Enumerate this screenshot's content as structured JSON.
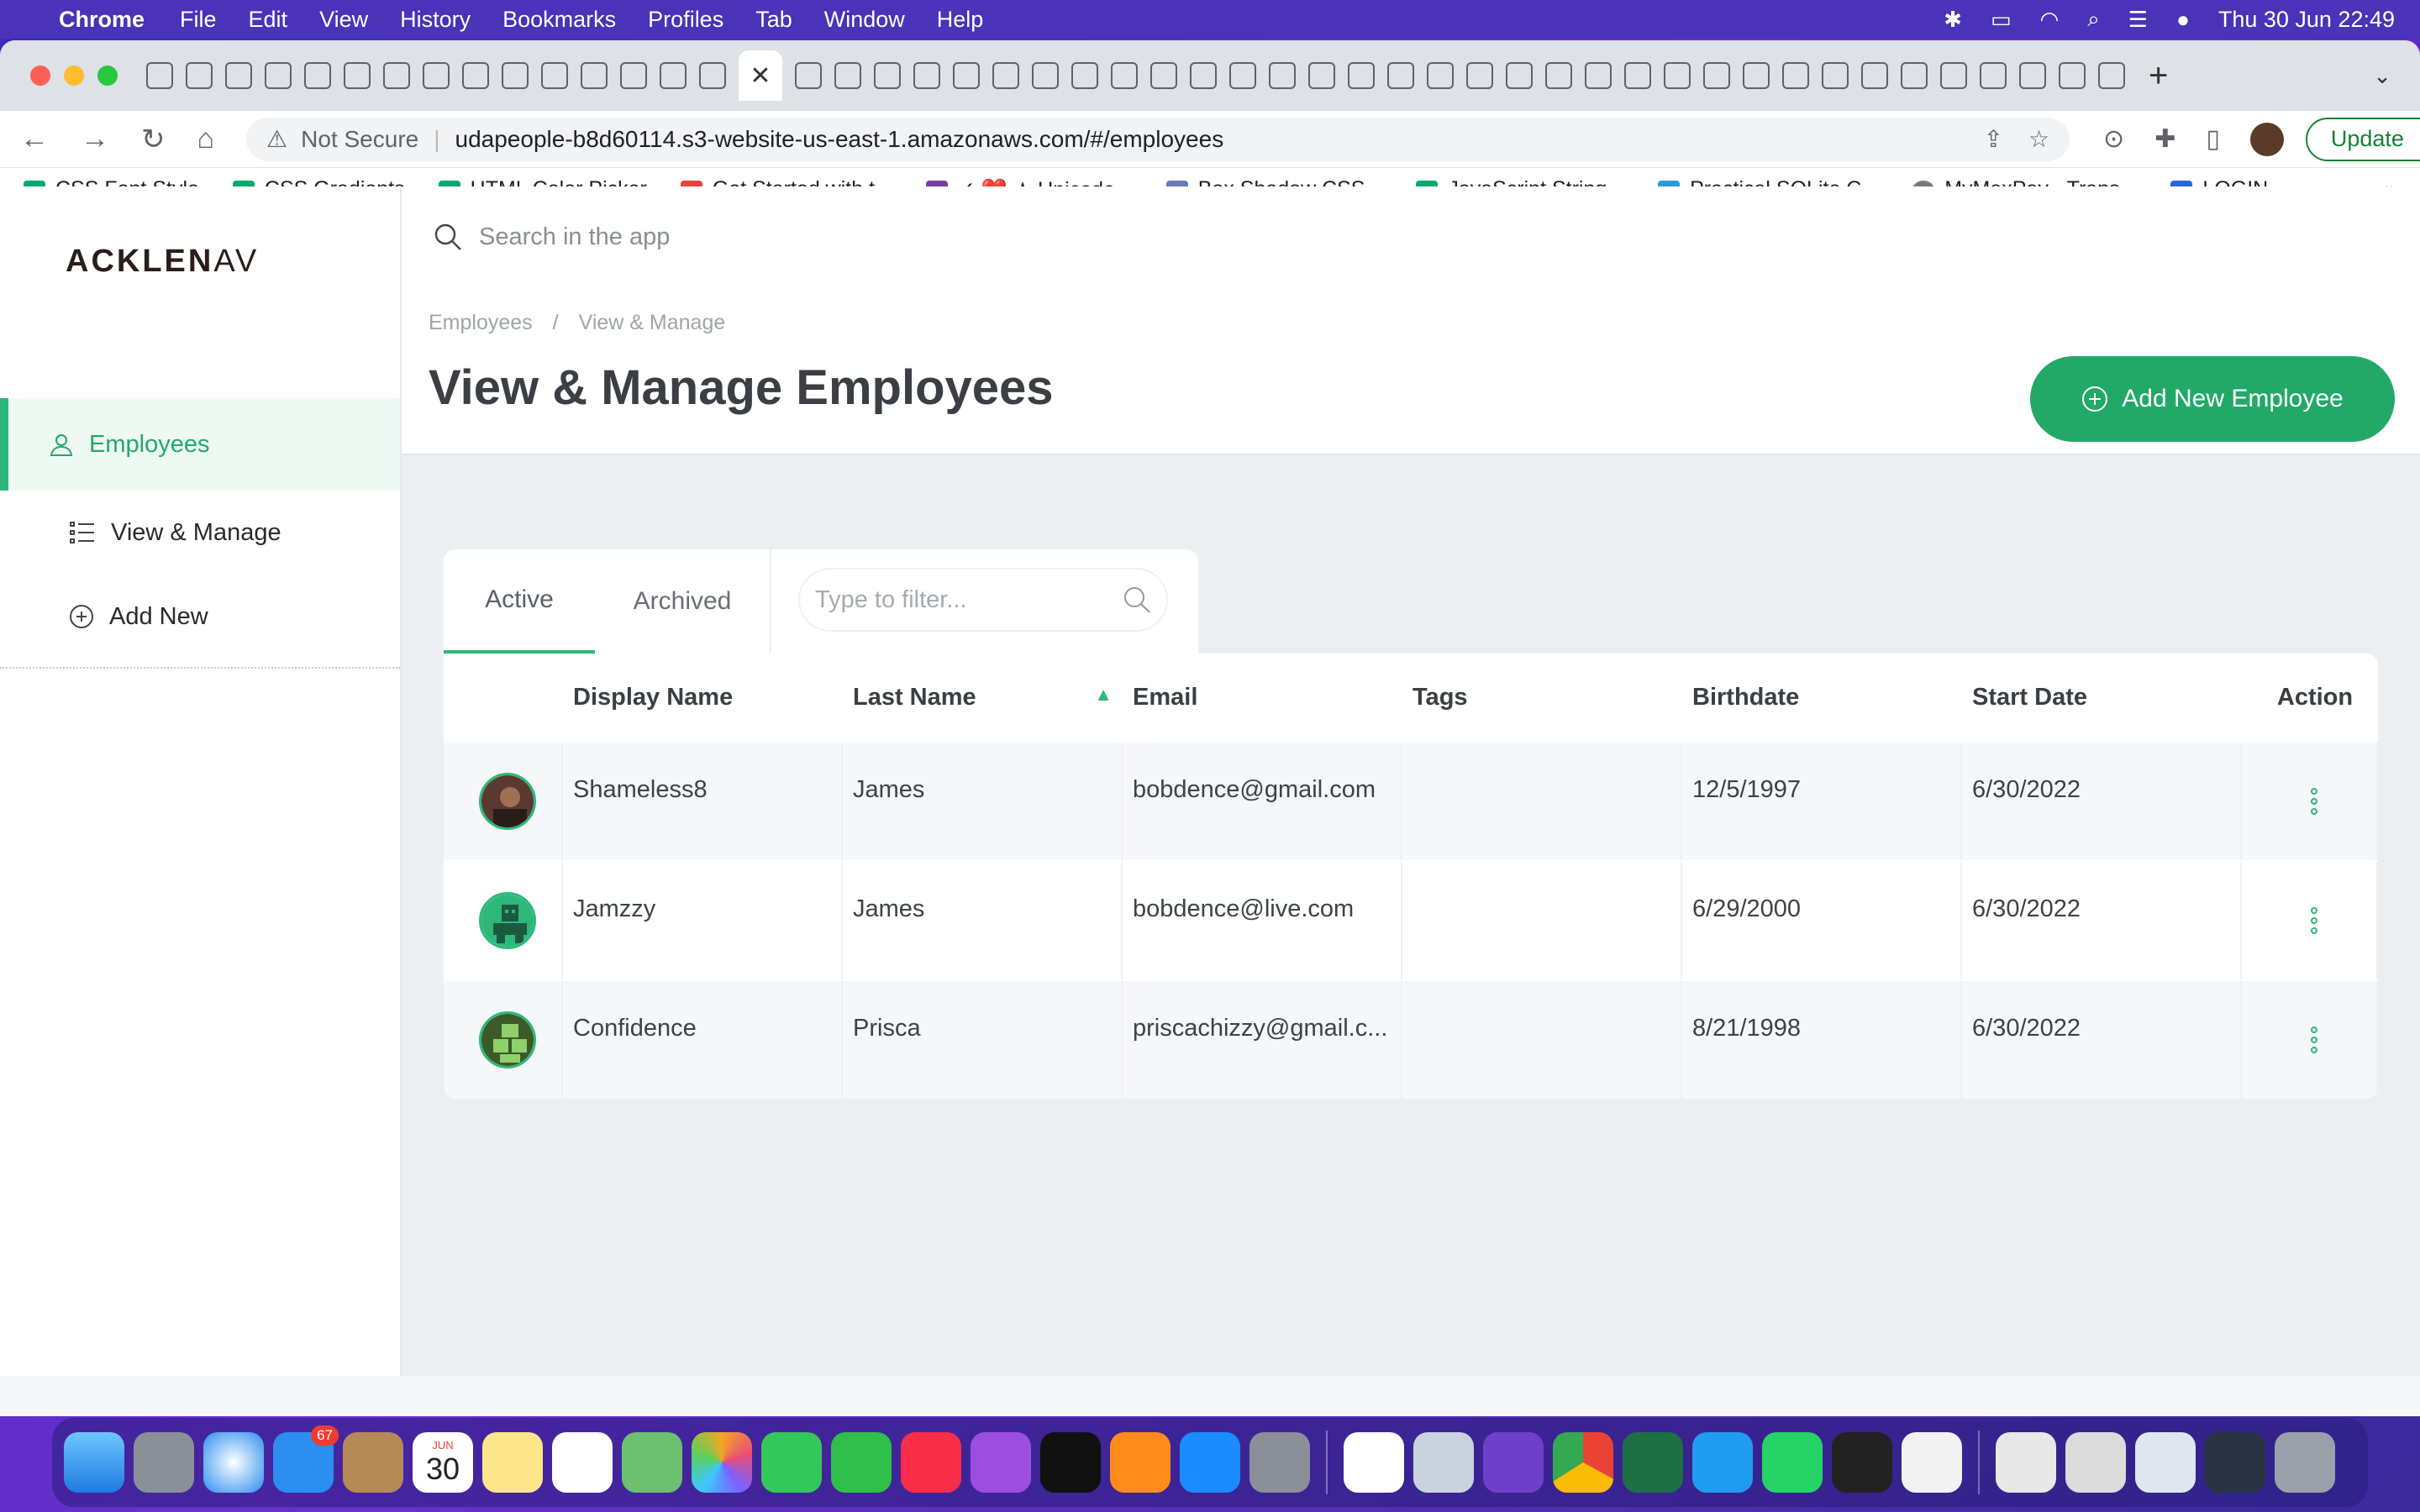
{
  "menubar": {
    "app_name": "Chrome",
    "items": [
      "File",
      "Edit",
      "View",
      "History",
      "Bookmarks",
      "Profiles",
      "Tab",
      "Window",
      "Help"
    ],
    "datetime": "Thu 30 Jun  22:49"
  },
  "browser": {
    "active_tab_close": "✕",
    "address": {
      "security_label": "Not Secure",
      "url": "udapeople-b8d60114.s3-website-us-east-1.amazonaws.com/#/employees"
    },
    "update_label": "Update",
    "bookmarks": [
      {
        "label": "CSS Font Style",
        "color": "#04aa6d"
      },
      {
        "label": "CSS Gradients",
        "color": "#04aa6d"
      },
      {
        "label": "HTML Color Picker",
        "color": "#04aa6d"
      },
      {
        "label": "Get Started with t...",
        "color": "#e8453c"
      },
      {
        "label": "✓ ❤️ ★ Unicode...",
        "color": "#7b3fa0"
      },
      {
        "label": "Box Shadow CSS...",
        "color": "#6b7bb8"
      },
      {
        "label": "JavaScript String...",
        "color": "#04aa6d"
      },
      {
        "label": "Practical SQLite C...",
        "color": "#2a9bd8"
      },
      {
        "label": "MyMaxPay - Trans...",
        "color": "#7a7a7a"
      },
      {
        "label": "LOGIN",
        "color": "#2a6ad8"
      }
    ],
    "bookmarks_more": "»"
  },
  "app": {
    "logo": {
      "bold": "ACKLEN",
      "light": "AV"
    },
    "search_placeholder": "Search in the app",
    "nav": {
      "section": "Employees",
      "items": [
        "View & Manage",
        "Add New"
      ]
    },
    "breadcrumb": [
      "Employees",
      "/",
      "View & Manage"
    ],
    "page_title": "View & Manage Employees",
    "add_button": "Add New Employee",
    "tabs": [
      "Active",
      "Archived"
    ],
    "filter_placeholder": "Type to filter...",
    "table": {
      "columns": [
        "Display Name",
        "Last Name",
        "Email",
        "Tags",
        "Birthdate",
        "Start Date",
        "Action"
      ],
      "rows": [
        {
          "display": "Shameless8",
          "last": "James",
          "email": "bobdence@gmail.com",
          "tags": "",
          "birth": "12/5/1997",
          "start": "6/30/2022"
        },
        {
          "display": "Jamzzy",
          "last": "James",
          "email": "bobdence@live.com",
          "tags": "",
          "birth": "6/29/2000",
          "start": "6/30/2022"
        },
        {
          "display": "Confidence",
          "last": "Prisca",
          "email": "priscachizzy@gmail.c...",
          "tags": "",
          "birth": "8/21/1998",
          "start": "6/30/2022"
        }
      ]
    }
  },
  "colors": {
    "accent": "#22a968",
    "sidebar_active_bg": "#eef9f4"
  },
  "dock": {
    "mail_badge": "67",
    "calendar_month": "JUN",
    "calendar_day": "30"
  }
}
